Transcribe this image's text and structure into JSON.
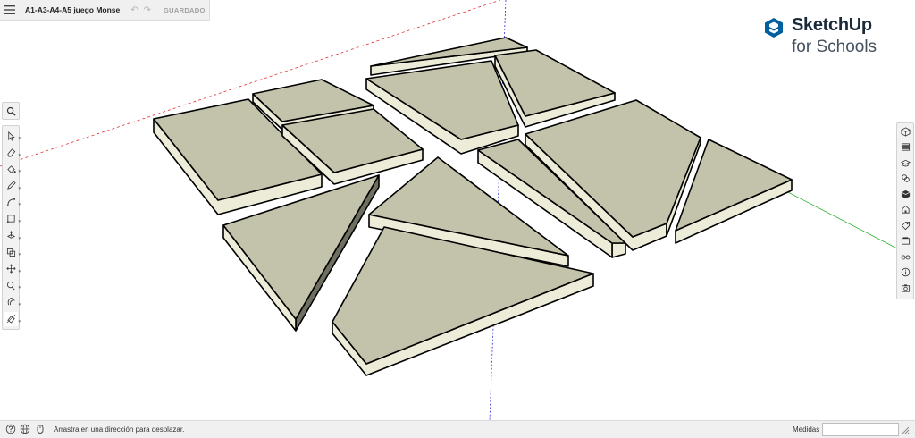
{
  "app": {
    "model_title": "A1-A3-A4-A5 juego Monse",
    "save_status": "GUARDADO"
  },
  "brand": {
    "name": "SketchUp",
    "subtitle": "for Schools",
    "color": "#005f9e"
  },
  "axes": {
    "red": "#e03030",
    "green": "#30b030",
    "blue": "#3030d8"
  },
  "face_color": "#c3c3ab",
  "side_color": "#ececd8",
  "search_tool": {
    "icon": "search-icon"
  },
  "left_toolbar": [
    {
      "name": "select",
      "icon": "select-arrow-icon"
    },
    {
      "name": "eraser",
      "icon": "eraser-icon"
    },
    {
      "name": "paint-bucket",
      "icon": "paint-bucket-icon"
    },
    {
      "name": "line",
      "icon": "pencil-icon"
    },
    {
      "name": "arc",
      "icon": "arc-icon"
    },
    {
      "name": "rectangle",
      "icon": "rectangle-icon"
    },
    {
      "name": "push-pull",
      "icon": "push-pull-icon"
    },
    {
      "name": "offset",
      "icon": "offset-icon"
    },
    {
      "name": "move",
      "icon": "move-icon"
    },
    {
      "name": "tape-measure",
      "icon": "tape-measure-icon"
    },
    {
      "name": "orbit",
      "icon": "orbit-icon"
    },
    {
      "name": "section",
      "icon": "section-plane-icon"
    }
  ],
  "right_toolbar": [
    {
      "name": "entity-info",
      "icon": "cube-info-icon"
    },
    {
      "name": "instructor",
      "icon": "layers-icon"
    },
    {
      "name": "learn",
      "icon": "graduation-cap-icon"
    },
    {
      "name": "materials",
      "icon": "materials-icon"
    },
    {
      "name": "components",
      "icon": "component-icon"
    },
    {
      "name": "styles",
      "icon": "styles-icon"
    },
    {
      "name": "tags",
      "icon": "tag-icon"
    },
    {
      "name": "scenes",
      "icon": "scenes-icon"
    },
    {
      "name": "display",
      "icon": "glasses-icon"
    },
    {
      "name": "info",
      "icon": "info-icon"
    },
    {
      "name": "export",
      "icon": "camera-icon"
    }
  ],
  "status": {
    "message": "Arrastra en una dirección para desplazar.",
    "measure_label": "Medidas",
    "measure_value": ""
  }
}
